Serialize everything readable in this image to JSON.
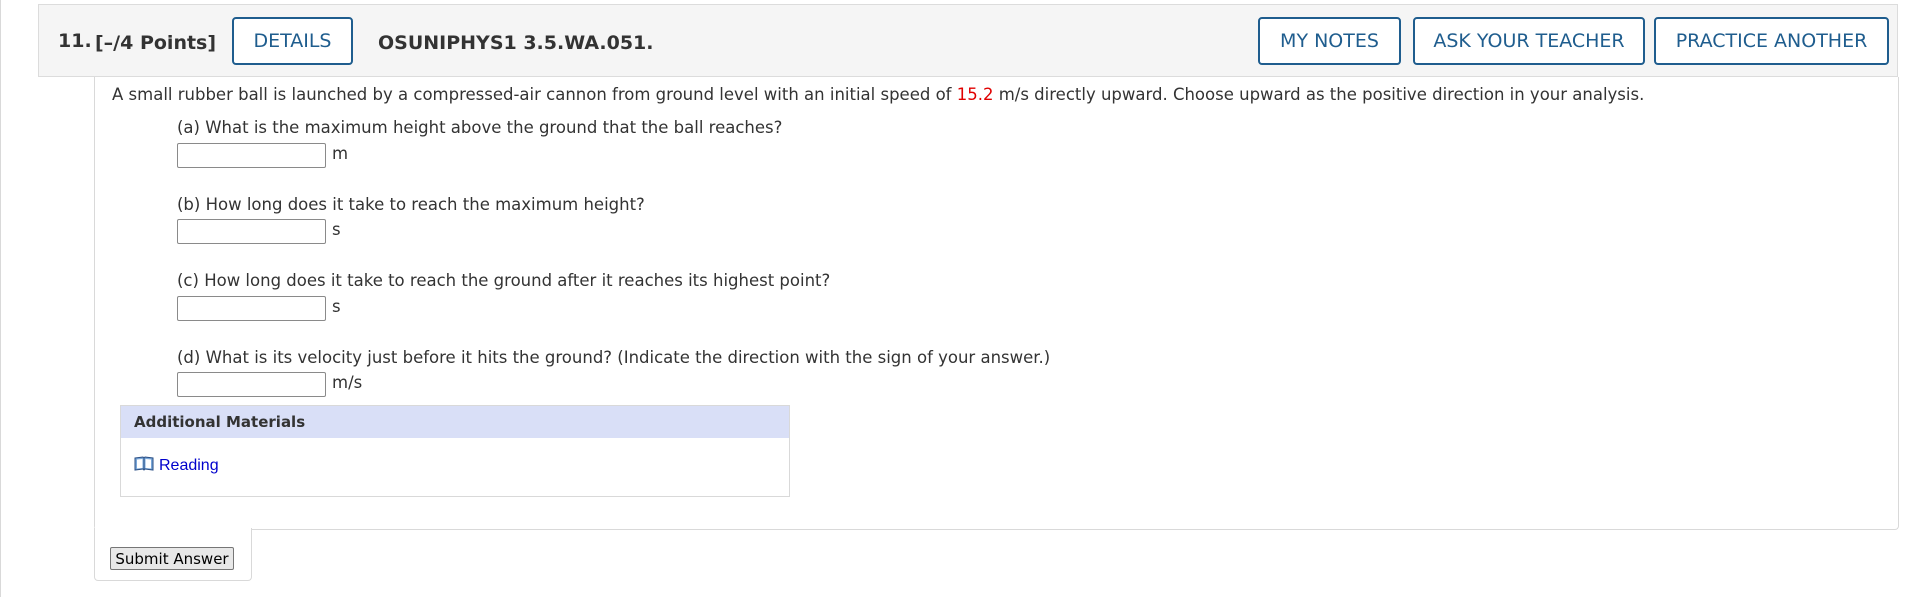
{
  "header": {
    "question_number": "11.",
    "points": "[–/4 Points]",
    "details_label": "DETAILS",
    "question_code": "OSUNIPHYS1 3.5.WA.051.",
    "my_notes_label": "MY NOTES",
    "ask_teacher_label": "ASK YOUR TEACHER",
    "practice_another_label": "PRACTICE ANOTHER"
  },
  "question": {
    "intro_before": "A small rubber ball is launched by a compressed-air cannon from ground level with an initial speed of ",
    "initial_speed": "15.2",
    "intro_after": " m/s directly upward. Choose upward as the positive direction in your analysis.",
    "highlight_color": "#e00000",
    "parts": [
      {
        "label": "(a) What is the maximum height above the ground that the ball reaches?",
        "value": "",
        "unit": "m"
      },
      {
        "label": "(b) How long does it take to reach the maximum height?",
        "value": "",
        "unit": "s"
      },
      {
        "label": "(c) How long does it take to reach the ground after it reaches its highest point?",
        "value": "",
        "unit": "s"
      },
      {
        "label": "(d) What is its velocity just before it hits the ground? (Indicate the direction with the sign of your answer.)",
        "value": "",
        "unit": "m/s"
      }
    ]
  },
  "additional_materials": {
    "title": "Additional Materials",
    "items": [
      {
        "label": "Reading",
        "icon": "book-icon"
      }
    ]
  },
  "submit": {
    "label": "Submit Answer"
  },
  "colors": {
    "accent": "#1f5d8e",
    "link": "#0000cc",
    "materials_header": "#d9dff7"
  }
}
